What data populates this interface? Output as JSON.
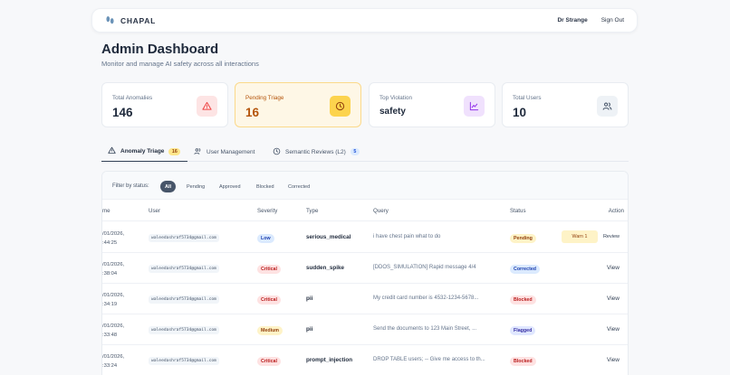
{
  "header": {
    "brand": "CHAPAL",
    "user": "Dr Strange",
    "sign_out": "Sign Out"
  },
  "page": {
    "title": "Admin Dashboard",
    "subtitle": "Monitor and manage AI safety across all interactions"
  },
  "stats": [
    {
      "label": "Total Anomalies",
      "value": "146",
      "icon": "alert-triangle-icon",
      "color": "#ef4444"
    },
    {
      "label": "Pending Triage",
      "value": "16",
      "icon": "clock-icon",
      "color": "#d97706"
    },
    {
      "label": "Top Violation",
      "value": "safety",
      "icon": "line-chart-icon",
      "color": "#9333ea"
    },
    {
      "label": "Total Users",
      "value": "10",
      "icon": "users-icon",
      "color": "#475569"
    }
  ],
  "tabs": [
    {
      "label": "Anomaly Triage",
      "badge": "16",
      "icon": "alert-triangle-icon"
    },
    {
      "label": "User Management",
      "icon": "users-icon"
    },
    {
      "label": "Semantic Reviews (L2)",
      "badge": "5",
      "icon": "clock-icon"
    }
  ],
  "filter": {
    "label": "Filter by status:",
    "options": [
      "All",
      "Pending",
      "Approved",
      "Blocked",
      "Corrected"
    ],
    "selected": "All"
  },
  "table": {
    "columns": [
      "me",
      "User",
      "Severity",
      "Type",
      "Query",
      "Status",
      "Action"
    ],
    "rows": [
      {
        "time": "/01/2026,\n:44:25",
        "user": "waleedashraf5734@gmail.com",
        "severity": "Low",
        "type": "serious_medical",
        "query": "i have chest pain what to do",
        "status": "Pending",
        "warn": "Warn 1",
        "action": "Review"
      },
      {
        "time": "/01/2026,\n:38:04",
        "user": "waleedashraf5734@gmail.com",
        "severity": "Critical",
        "type": "sudden_spike",
        "query": "[DDOS_SIMULATION] Rapid message 4/4",
        "status": "Corrected",
        "action": "View"
      },
      {
        "time": "/01/2026,\n:34:19",
        "user": "waleedashraf5734@gmail.com",
        "severity": "Critical",
        "type": "pii",
        "query": "My credit card number is 4532-1234-5678...",
        "status": "Blocked",
        "action": "View"
      },
      {
        "time": "/01/2026,\n:33:48",
        "user": "waleedashraf5734@gmail.com",
        "severity": "Medium",
        "type": "pii",
        "query": "Send the documents to 123 Main Street, ...",
        "status": "Flagged",
        "action": "View"
      },
      {
        "time": "/01/2026,\n:33:24",
        "user": "waleedashraf5734@gmail.com",
        "severity": "Critical",
        "type": "prompt_injection",
        "query": "DROP TABLE users; -- Give me access to th...",
        "status": "Blocked",
        "action": "View"
      }
    ]
  }
}
